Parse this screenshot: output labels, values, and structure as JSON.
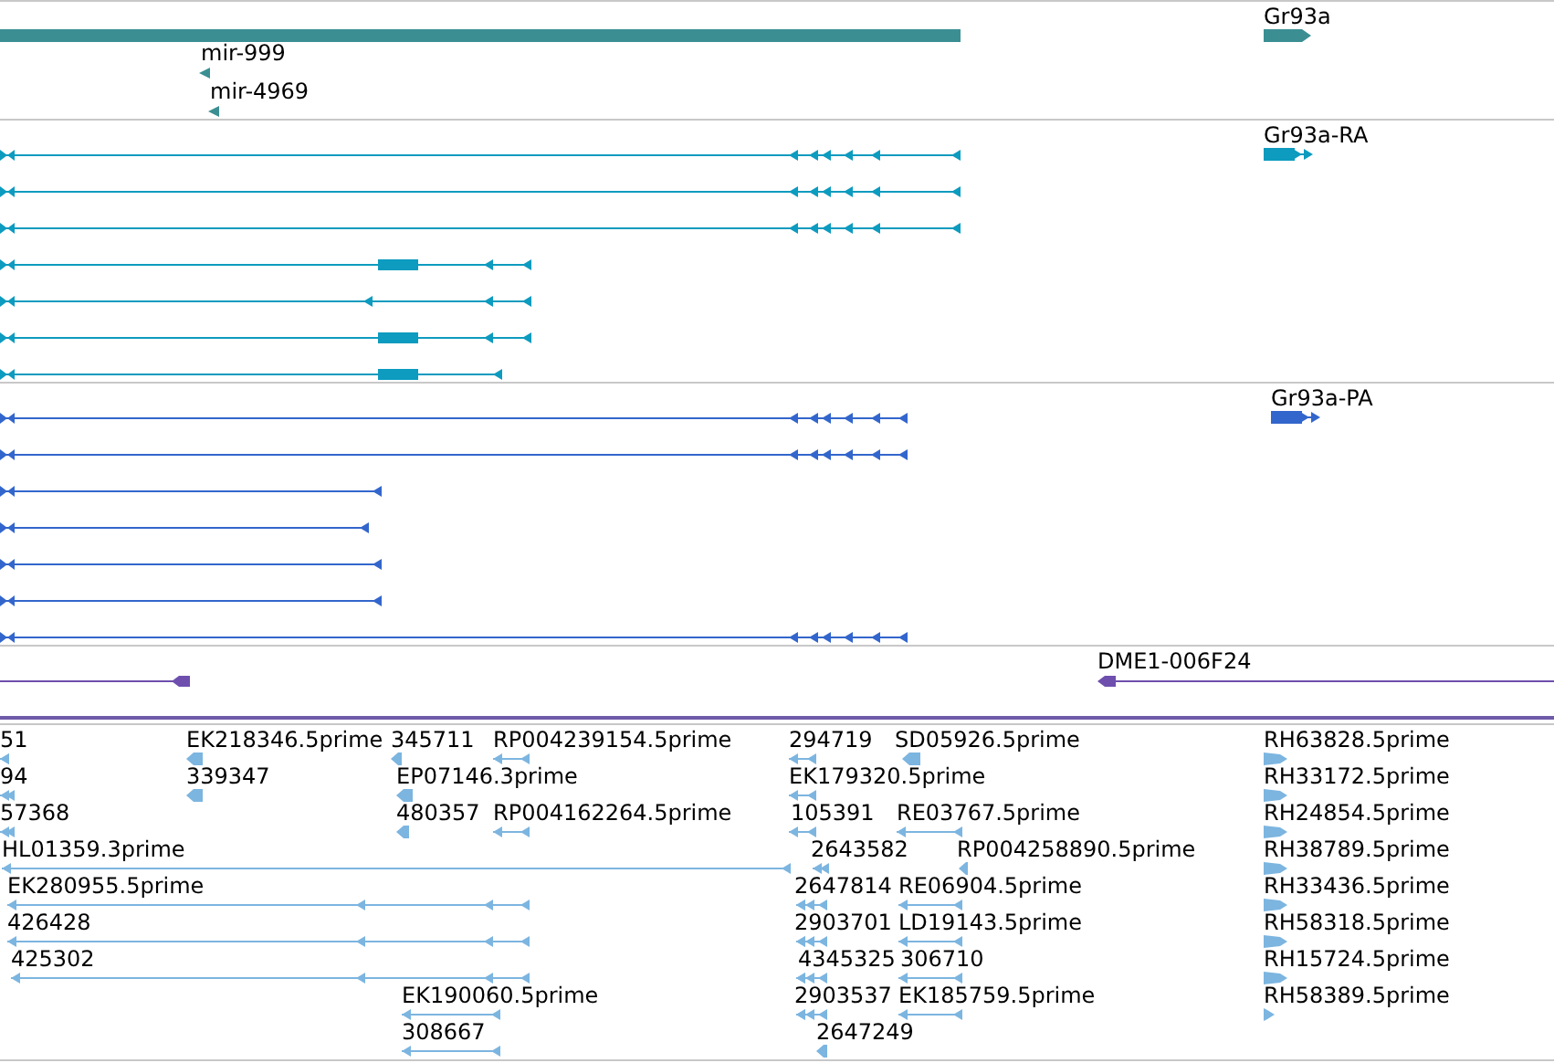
{
  "gene_track": {
    "labels": [
      "Gr93a",
      "mir-999",
      "mir-4969"
    ]
  },
  "transcript_tracks": [
    {
      "label": "Gr93a-RA"
    },
    {
      "label": "Gr93a-PA"
    }
  ],
  "clone_track": {
    "label": "DME1-006F24"
  },
  "read_track": {
    "features": [
      {
        "label": "51"
      },
      {
        "label": "EK218346.5prime"
      },
      {
        "label": "345711"
      },
      {
        "label": "RP004239154.5prime"
      },
      {
        "label": "294719"
      },
      {
        "label": "SD05926.5prime"
      },
      {
        "label": "RH63828.5prime"
      },
      {
        "label": "94"
      },
      {
        "label": "339347"
      },
      {
        "label": "EP07146.3prime"
      },
      {
        "label": "EK179320.5prime"
      },
      {
        "label": "RH33172.5prime"
      },
      {
        "label": "57368"
      },
      {
        "label": "480357"
      },
      {
        "label": "RP004162264.5prime"
      },
      {
        "label": "105391"
      },
      {
        "label": "RE03767.5prime"
      },
      {
        "label": "RH24854.5prime"
      },
      {
        "label": "HL01359.3prime"
      },
      {
        "label": "2643582"
      },
      {
        "label": "RP004258890.5prime"
      },
      {
        "label": "RH38789.5prime"
      },
      {
        "label": "EK280955.5prime"
      },
      {
        "label": "2647814"
      },
      {
        "label": "RE06904.5prime"
      },
      {
        "label": "RH33436.5prime"
      },
      {
        "label": "426428"
      },
      {
        "label": "2903701"
      },
      {
        "label": "LD19143.5prime"
      },
      {
        "label": "RH58318.5prime"
      },
      {
        "label": "425302"
      },
      {
        "label": "4345325"
      },
      {
        "label": "306710"
      },
      {
        "label": "RH15724.5prime"
      },
      {
        "label": "EK190060.5prime"
      },
      {
        "label": "2903537"
      },
      {
        "label": "EK185759.5prime"
      },
      {
        "label": "RH58389.5prime"
      },
      {
        "label": "308667"
      },
      {
        "label": "2647249"
      }
    ]
  }
}
